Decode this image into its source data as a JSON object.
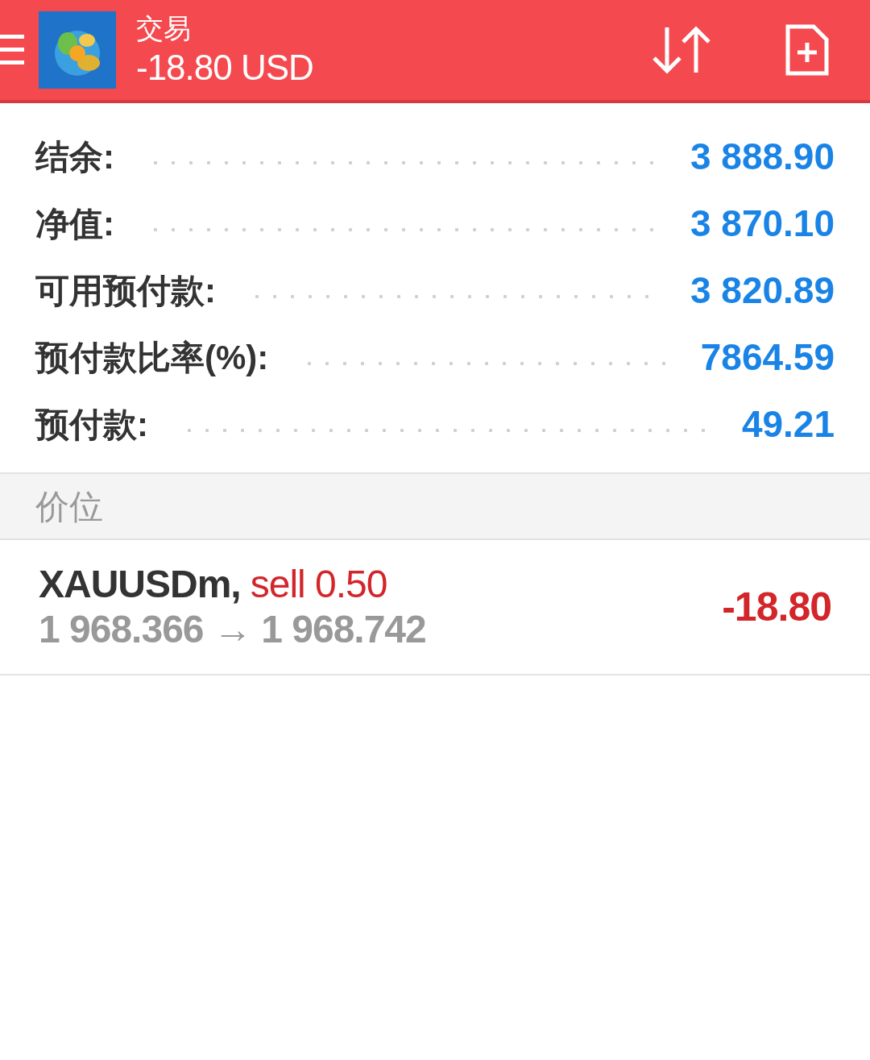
{
  "header": {
    "title": "交易",
    "profit": "-18.80 USD"
  },
  "summary": [
    {
      "label": "结余:",
      "value": "3 888.90"
    },
    {
      "label": "净值:",
      "value": "3 870.10"
    },
    {
      "label": "可用预付款:",
      "value": "3 820.89"
    },
    {
      "label": "预付款比率(%):",
      "value": "7864.59"
    },
    {
      "label": "预付款:",
      "value": "49.21"
    }
  ],
  "section": {
    "title": "价位"
  },
  "positions": [
    {
      "symbol": "XAUUSDm,",
      "direction": "sell 0.50",
      "prices": "1 968.366 → 1 968.742",
      "profit": "-18.80"
    }
  ]
}
